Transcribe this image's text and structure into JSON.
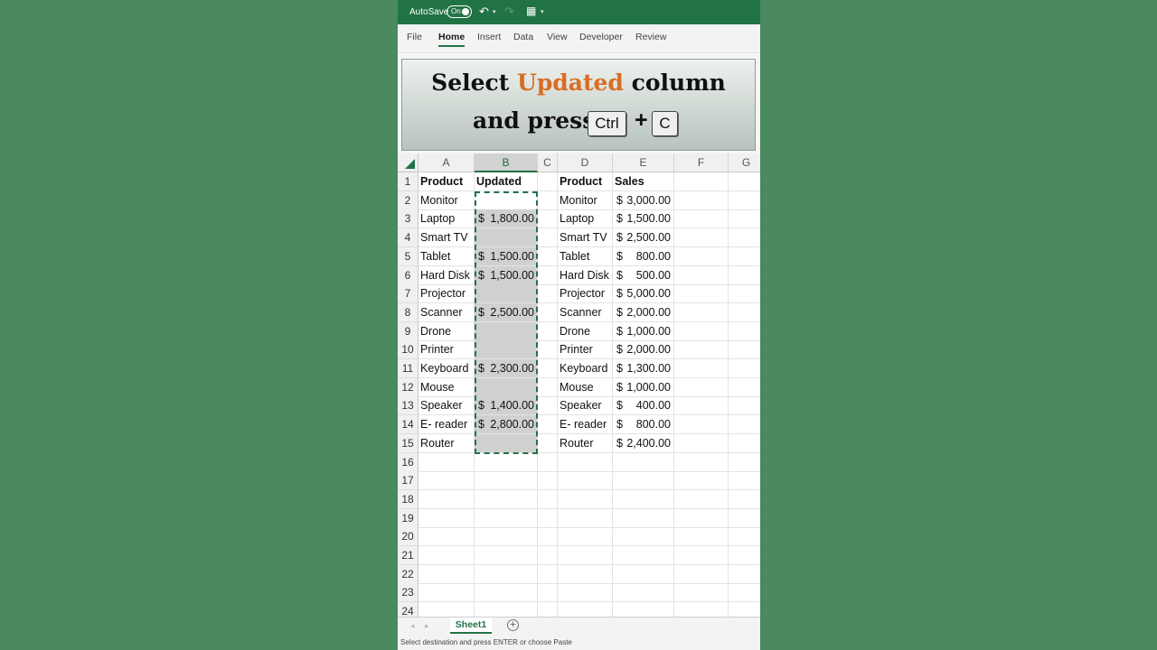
{
  "titlebar": {
    "autosave_label": "AutoSave",
    "toggle_label": "On"
  },
  "ribbon": {
    "tabs": [
      "File",
      "Home",
      "Insert",
      "Data",
      "View",
      "Developer",
      "Review"
    ],
    "active_tab": "Home"
  },
  "banner": {
    "line1_pre": "Select ",
    "line1_highlight": "Updated",
    "line1_post": " column",
    "line2": "and press",
    "key1": "Ctrl",
    "plus": "+",
    "key2": "C",
    "highlight_color": "#d96d24"
  },
  "sheet": {
    "columns": [
      "A",
      "B",
      "C",
      "D",
      "E",
      "F",
      "G"
    ],
    "selected_column": "B",
    "rows": [
      "1",
      "2",
      "3",
      "4",
      "5",
      "6",
      "7",
      "8",
      "9",
      "10",
      "11",
      "12",
      "13",
      "14",
      "15",
      "16",
      "17",
      "18",
      "19",
      "20",
      "21",
      "22",
      "23",
      "24"
    ],
    "headers": {
      "a1": "Product",
      "b1": "Updated",
      "d1": "Product",
      "e1": "Sales"
    },
    "products_a": [
      "Monitor",
      "Laptop",
      "Smart TV",
      "Tablet",
      "Hard Disk",
      "Projector",
      "Scanner",
      "Drone",
      "Printer",
      "Keyboard",
      "Mouse",
      "Speaker",
      "E- reader",
      "Router"
    ],
    "updated_b": [
      {
        "sym": "",
        "amt": ""
      },
      {
        "sym": "$",
        "amt": "1,800.00"
      },
      {
        "sym": "",
        "amt": ""
      },
      {
        "sym": "$",
        "amt": "1,500.00"
      },
      {
        "sym": "$",
        "amt": "1,500.00"
      },
      {
        "sym": "",
        "amt": ""
      },
      {
        "sym": "$",
        "amt": "2,500.00"
      },
      {
        "sym": "",
        "amt": ""
      },
      {
        "sym": "",
        "amt": ""
      },
      {
        "sym": "$",
        "amt": "2,300.00"
      },
      {
        "sym": "",
        "amt": ""
      },
      {
        "sym": "$",
        "amt": "1,400.00"
      },
      {
        "sym": "$",
        "amt": "2,800.00"
      },
      {
        "sym": "",
        "amt": ""
      }
    ],
    "products_d": [
      "Monitor",
      "Laptop",
      "Smart TV",
      "Tablet",
      "Hard Disk",
      "Projector",
      "Scanner",
      "Drone",
      "Printer",
      "Keyboard",
      "Mouse",
      "Speaker",
      "E- reader",
      "Router"
    ],
    "sales_e": [
      {
        "sym": "$",
        "amt": "3,000.00"
      },
      {
        "sym": "$",
        "amt": "1,500.00"
      },
      {
        "sym": "$",
        "amt": "2,500.00"
      },
      {
        "sym": "$",
        "amt": "800.00"
      },
      {
        "sym": "$",
        "amt": "500.00"
      },
      {
        "sym": "$",
        "amt": "5,000.00"
      },
      {
        "sym": "$",
        "amt": "2,000.00"
      },
      {
        "sym": "$",
        "amt": "1,000.00"
      },
      {
        "sym": "$",
        "amt": "2,000.00"
      },
      {
        "sym": "$",
        "amt": "1,300.00"
      },
      {
        "sym": "$",
        "amt": "1,000.00"
      },
      {
        "sym": "$",
        "amt": "400.00"
      },
      {
        "sym": "$",
        "amt": "800.00"
      },
      {
        "sym": "$",
        "amt": "2,400.00"
      }
    ]
  },
  "sheet_tabs": {
    "active": "Sheet1",
    "add": "+"
  },
  "status": "Select destination and press ENTER or choose Paste",
  "colors": {
    "excel_green": "#217346",
    "background": "#4a8a5e"
  }
}
